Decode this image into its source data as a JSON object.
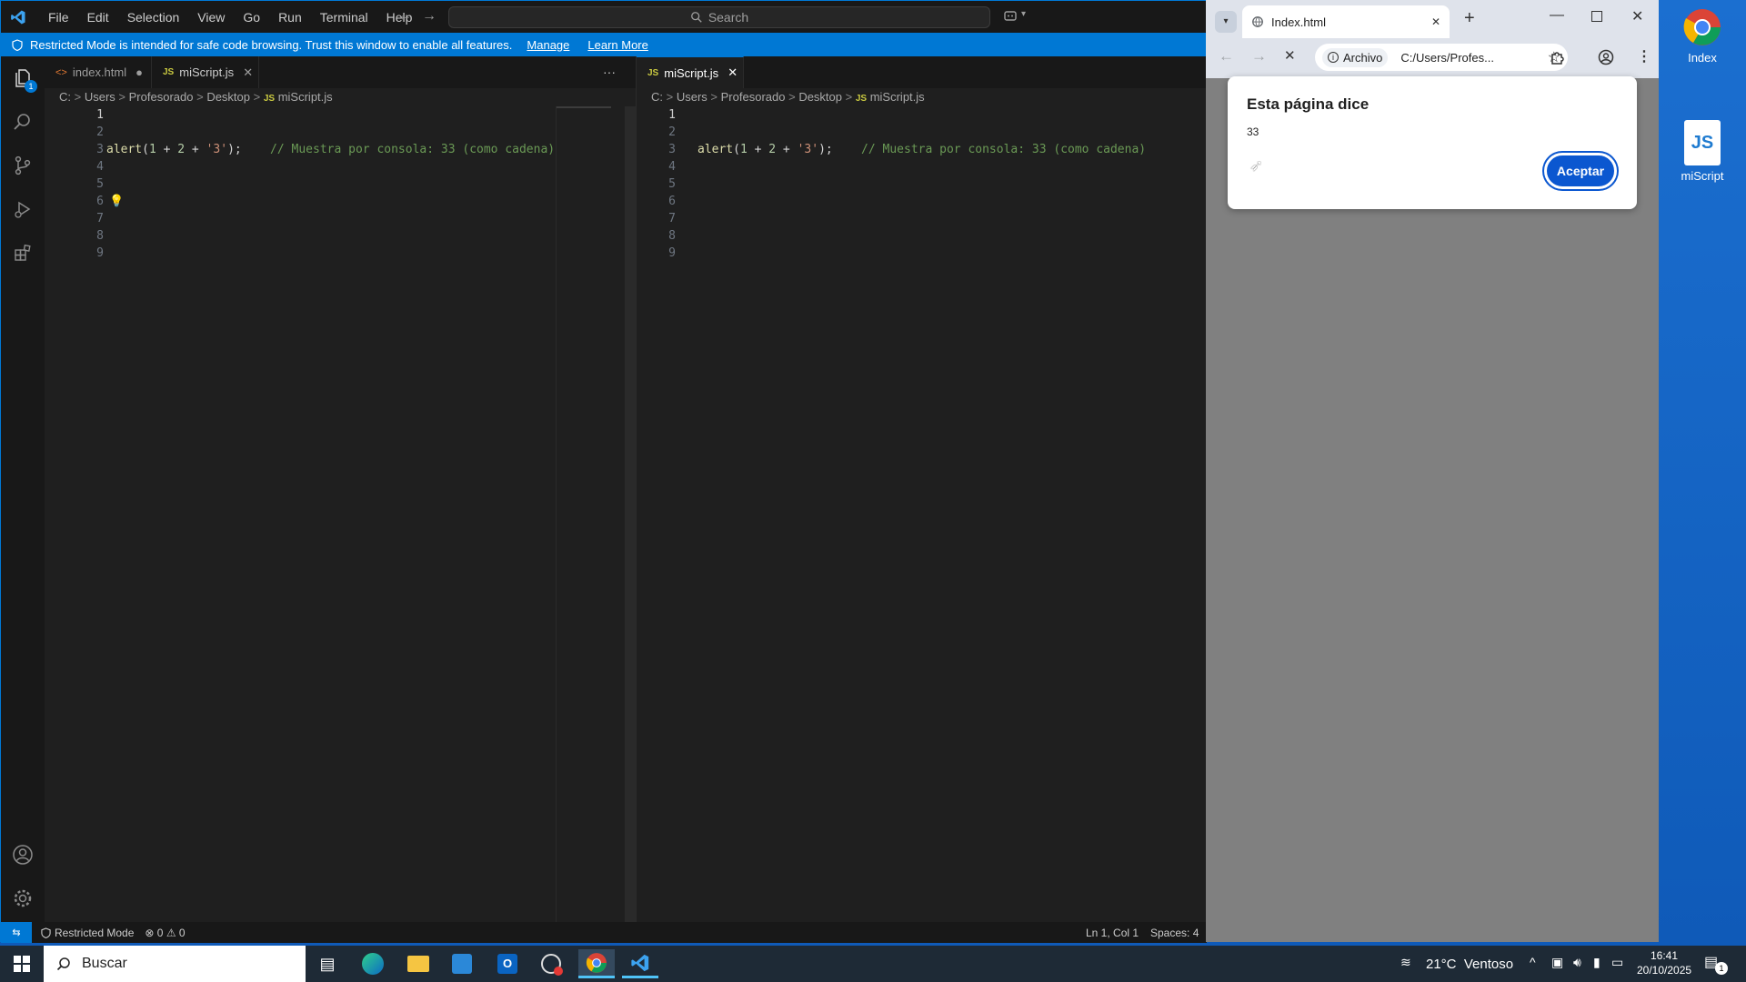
{
  "vscode": {
    "menu": [
      "File",
      "Edit",
      "Selection",
      "View",
      "Go",
      "Run",
      "Terminal",
      "Help"
    ],
    "search_label": "Search",
    "banner": {
      "text": "Restricted Mode is intended for safe code browsing. Trust this window to enable all features.",
      "manage": "Manage",
      "learn_more": "Learn More"
    },
    "activity_badge": "1",
    "left_pane": {
      "tabs": [
        {
          "label": "index.html"
        },
        {
          "label": "miScript.js"
        }
      ],
      "breadcrumb": [
        "C:",
        "Users",
        "Profesorado",
        "Desktop",
        "miScript.js"
      ],
      "more": "···"
    },
    "right_pane": {
      "tabs": [
        {
          "label": "miScript.js"
        }
      ],
      "breadcrumb": [
        "C:",
        "Users",
        "Profesorado",
        "Desktop",
        "miScript.js"
      ]
    },
    "line_numbers": [
      "1",
      "2",
      "3",
      "4",
      "5",
      "6",
      "7",
      "8",
      "9"
    ],
    "code_line1": {
      "fn": "alert",
      "p1": "(",
      "n1": "1",
      "op1": " + ",
      "n2": "2",
      "op2": " + ",
      "s": "'3'",
      "p2": ");",
      "comment": "    // Muestra por consola: 33 (como cadena)"
    },
    "statusbar": {
      "restricted": "Restricted Mode",
      "errors": "0",
      "warnings": "0",
      "position": "Ln 1, Col 1",
      "spaces": "Spaces: 4"
    }
  },
  "chrome": {
    "tab_title": "Index.html",
    "omnibox_label": "Archivo",
    "omnibox_url": "C:/Users/Profes...",
    "dialog": {
      "title": "Esta página dice",
      "message": "33",
      "ok_label": "Aceptar"
    }
  },
  "desktop_icons": [
    {
      "label": "Index"
    },
    {
      "label": "miScript"
    }
  ],
  "taskbar": {
    "search_placeholder": "Buscar",
    "weather": "21°C  Ventoso",
    "time": "16:41",
    "date": "20/10/2025",
    "notif_count": "1"
  }
}
